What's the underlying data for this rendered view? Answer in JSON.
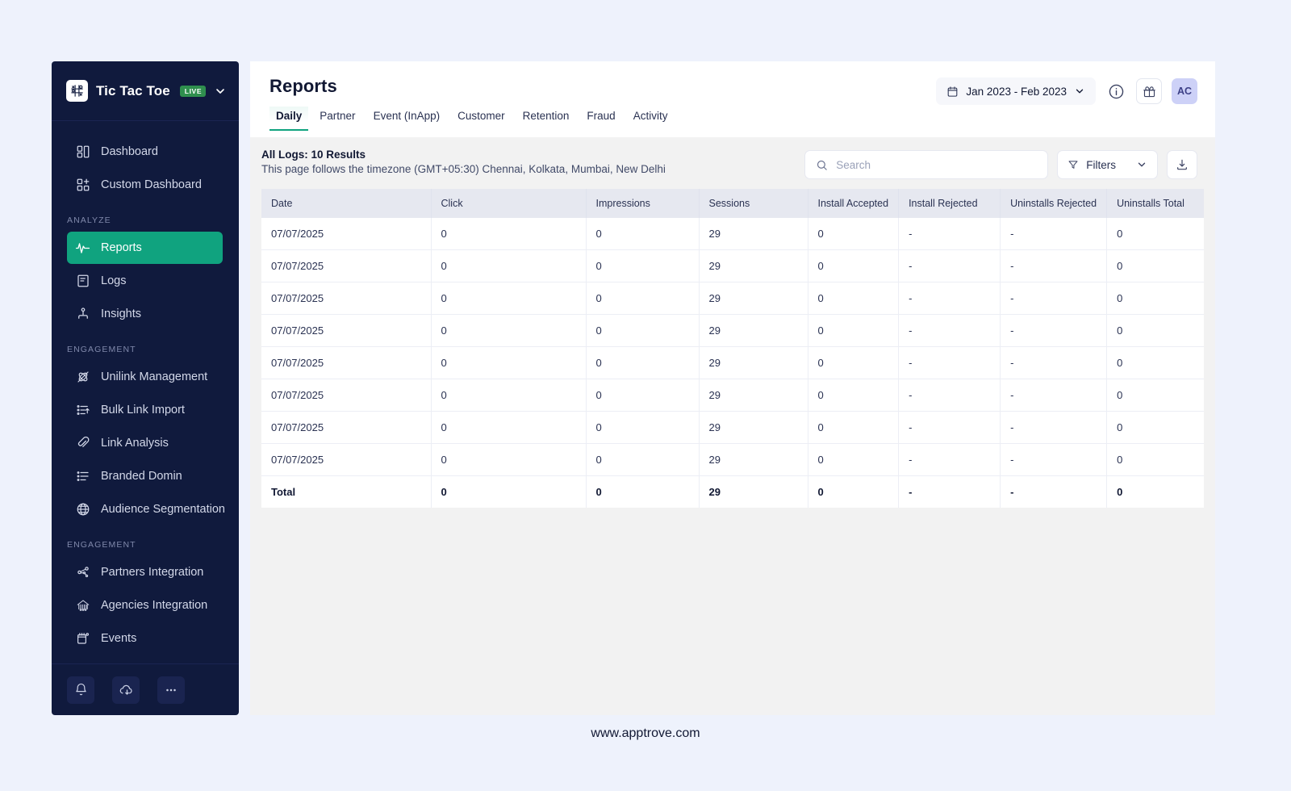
{
  "brand": {
    "name": "Tic Tac Toe",
    "badge": "LIVE",
    "logo_icon": "tic-tac-toe-logo-icon",
    "caret_icon": "chevron-down-icon"
  },
  "sidebar": {
    "top_items": [
      {
        "label": "Dashboard",
        "icon": "dashboard-icon"
      },
      {
        "label": "Custom Dashboard",
        "icon": "custom-dashboard-icon"
      }
    ],
    "sections": [
      {
        "title": "ANALYZE",
        "items": [
          {
            "label": "Reports",
            "icon": "pulse-icon",
            "active": true
          },
          {
            "label": "Logs",
            "icon": "logs-icon",
            "active": false
          },
          {
            "label": "Insights",
            "icon": "insights-icon",
            "active": false
          }
        ]
      },
      {
        "title": "ENGAGEMENT",
        "items": [
          {
            "label": "Unilink Management",
            "icon": "unilink-icon",
            "active": false
          },
          {
            "label": "Bulk Link Import",
            "icon": "bulk-import-icon",
            "active": false
          },
          {
            "label": "Link Analysis",
            "icon": "link-icon",
            "active": false
          },
          {
            "label": "Branded Domin",
            "icon": "branded-domain-icon",
            "active": false
          },
          {
            "label": "Audience Segmentation",
            "icon": "globe-icon",
            "active": false
          }
        ]
      },
      {
        "title": "ENGAGEMENT",
        "items": [
          {
            "label": "Partners Integration",
            "icon": "partners-icon",
            "active": false
          },
          {
            "label": "Agencies Integration",
            "icon": "agencies-icon",
            "active": false
          },
          {
            "label": "Events",
            "icon": "calendar-events-icon",
            "active": false
          }
        ]
      }
    ],
    "footer_buttons": [
      {
        "icon": "bell-icon"
      },
      {
        "icon": "cloud-download-icon"
      },
      {
        "icon": "more-horizontal-icon"
      }
    ],
    "colors": {
      "background": "#101a3d",
      "active": "#10a37f"
    }
  },
  "header": {
    "title": "Reports",
    "tabs": [
      {
        "label": "Daily",
        "active": true
      },
      {
        "label": "Partner",
        "active": false
      },
      {
        "label": "Event (InApp)",
        "active": false
      },
      {
        "label": "Customer",
        "active": false
      },
      {
        "label": "Retention",
        "active": false
      },
      {
        "label": "Fraud",
        "active": false
      },
      {
        "label": "Activity",
        "active": false
      }
    ],
    "date_range": "Jan 2023 - Feb 2023",
    "date_icon": "calendar-icon",
    "date_caret_icon": "chevron-down-icon",
    "info_icon": "info-icon",
    "gift_icon": "gift-icon",
    "avatar_initials": "AC"
  },
  "toolbar": {
    "logs_title": "All Logs: 10 Results",
    "logs_subtitle": "This page follows the timezone (GMT+05:30) Chennai, Kolkata, Mumbai, New Delhi",
    "search_placeholder": "Search",
    "search_value": "",
    "search_icon": "search-icon",
    "filters_label": "Filters",
    "filters_icon": "funnel-icon",
    "filters_caret_icon": "chevron-down-icon",
    "download_icon": "download-icon"
  },
  "table": {
    "columns": [
      "Date",
      "Click",
      "Impressions",
      "Sessions",
      "Install Accepted",
      "Install Rejected",
      "Uninstalls Rejected",
      "Uninstalls Total"
    ],
    "rows": [
      [
        "07/07/2025",
        "0",
        "0",
        "29",
        "0",
        "-",
        "-",
        "0"
      ],
      [
        "07/07/2025",
        "0",
        "0",
        "29",
        "0",
        "-",
        "-",
        "0"
      ],
      [
        "07/07/2025",
        "0",
        "0",
        "29",
        "0",
        "-",
        "-",
        "0"
      ],
      [
        "07/07/2025",
        "0",
        "0",
        "29",
        "0",
        "-",
        "-",
        "0"
      ],
      [
        "07/07/2025",
        "0",
        "0",
        "29",
        "0",
        "-",
        "-",
        "0"
      ],
      [
        "07/07/2025",
        "0",
        "0",
        "29",
        "0",
        "-",
        "-",
        "0"
      ],
      [
        "07/07/2025",
        "0",
        "0",
        "29",
        "0",
        "-",
        "-",
        "0"
      ],
      [
        "07/07/2025",
        "0",
        "0",
        "29",
        "0",
        "-",
        "-",
        "0"
      ]
    ],
    "total_row": [
      "Total",
      "0",
      "0",
      "29",
      "0",
      "-",
      "-",
      "0"
    ]
  },
  "footer": {
    "url": "www.apptrove.com"
  }
}
